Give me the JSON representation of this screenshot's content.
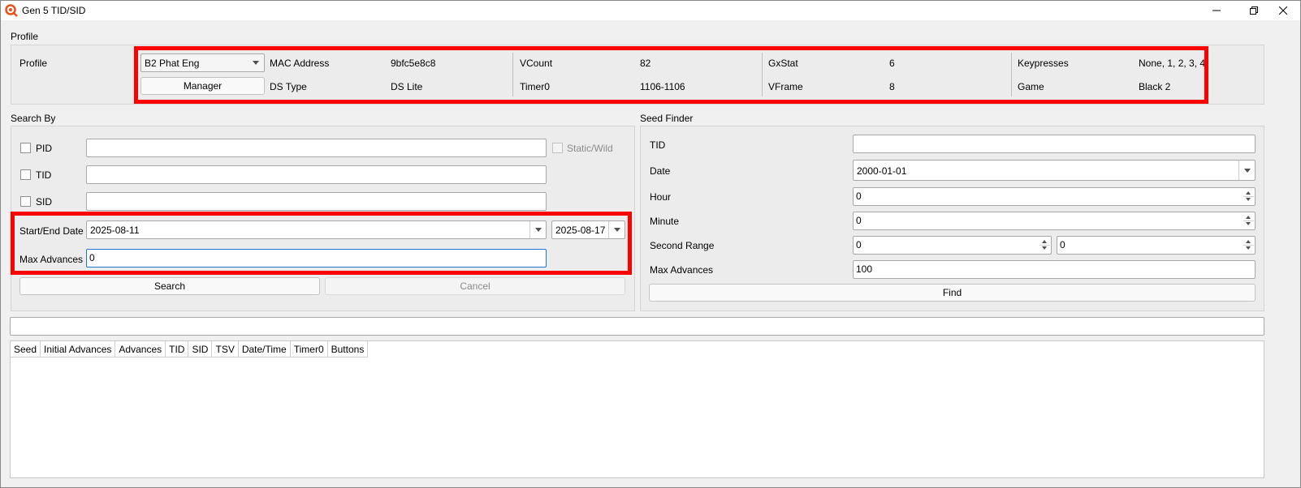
{
  "window": {
    "title": "Gen 5 TID/SID"
  },
  "profile": {
    "group_title": "Profile",
    "label": "Profile",
    "selected": "B2 Phat Eng",
    "manager_label": "Manager",
    "fields": {
      "mac_label": "MAC Address",
      "mac_value": "9bfc5e8c8",
      "ds_type_label": "DS Type",
      "ds_type_value": "DS Lite",
      "vcount_label": "VCount",
      "vcount_value": "82",
      "timer0_label": "Timer0",
      "timer0_value": "1106-1106",
      "gxstat_label": "GxStat",
      "gxstat_value": "6",
      "vframe_label": "VFrame",
      "vframe_value": "8",
      "keypresses_label": "Keypresses",
      "keypresses_value": "None, 1, 2, 3, 4",
      "game_label": "Game",
      "game_value": "Black 2"
    }
  },
  "search_by": {
    "title": "Search By",
    "pid_label": "PID",
    "pid_value": "",
    "static_wild_label": "Static/Wild",
    "tid_label": "TID",
    "tid_value": "",
    "sid_label": "SID",
    "sid_value": "",
    "date_label": "Start/End Date",
    "start_date": "2025-08-11",
    "end_date": "2025-08-17",
    "max_advances_label": "Max Advances",
    "max_advances_value": "0",
    "search_label": "Search",
    "cancel_label": "Cancel"
  },
  "seed_finder": {
    "title": "Seed Finder",
    "tid_label": "TID",
    "tid_value": "",
    "date_label": "Date",
    "date_value": "2000-01-01",
    "hour_label": "Hour",
    "hour_value": "0",
    "minute_label": "Minute",
    "minute_value": "0",
    "second_range_label": "Second Range",
    "second_min": "0",
    "second_max": "0",
    "max_advances_label": "Max Advances",
    "max_advances_value": "100",
    "find_label": "Find"
  },
  "filter": {
    "value": ""
  },
  "results": {
    "columns": [
      "Seed",
      "Initial Advances",
      "Advances",
      "TID",
      "SID",
      "TSV",
      "Date/Time",
      "Timer0",
      "Buttons"
    ]
  },
  "colors": {
    "highlight": "#ff0000",
    "focus": "#1c76d2"
  }
}
